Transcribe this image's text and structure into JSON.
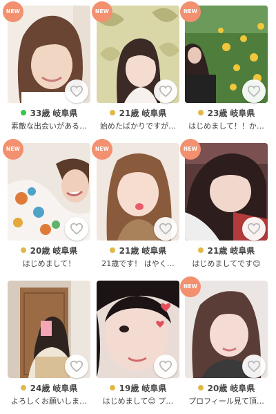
{
  "colors": {
    "new_badge": "#f2906f",
    "online_dot": "#34c84a",
    "recent_dot": "#e0b84a",
    "like_icon": "#b9b9b9"
  },
  "profiles": [
    {
      "new": "NEW",
      "age_label": "33歳",
      "location": "岐阜県",
      "status": "online",
      "message": "素敵な出会いがある…",
      "like_icon": "heart-outline-icon"
    },
    {
      "new": "NEW",
      "age_label": "21歳",
      "location": "岐阜県",
      "status": "recent",
      "message": "始めたばかりですが…",
      "like_icon": "heart-outline-icon"
    },
    {
      "new": "NEW",
      "age_label": "23歳",
      "location": "岐阜県",
      "status": "recent",
      "message": "はじめまして！！か…",
      "like_icon": "heart-outline-icon"
    },
    {
      "new": "NEW",
      "age_label": "20歳",
      "location": "岐阜県",
      "status": "recent",
      "message": "はじめまして！",
      "like_icon": "heart-outline-icon"
    },
    {
      "new": "NEW",
      "age_label": "21歳",
      "location": "岐阜県",
      "status": "recent",
      "message": "21歳です！ はやく…",
      "like_icon": "heart-outline-icon"
    },
    {
      "new": "NEW",
      "age_label": "21歳",
      "location": "岐阜県",
      "status": "recent",
      "message": "はじめましてです😊",
      "like_icon": "heart-outline-icon"
    },
    {
      "new": "",
      "age_label": "24歳",
      "location": "岐阜県",
      "status": "recent",
      "message": "よろしくお願いしま…",
      "like_icon": "heart-outline-icon"
    },
    {
      "new": "",
      "age_label": "19歳",
      "location": "岐阜県",
      "status": "recent",
      "message": "はじめまして😊 プ…",
      "like_icon": "heart-outline-icon"
    },
    {
      "new": "NEW",
      "age_label": "20歳",
      "location": "岐阜県",
      "status": "recent",
      "message": "プロフィール見て頂…",
      "like_icon": "heart-outline-icon"
    }
  ]
}
